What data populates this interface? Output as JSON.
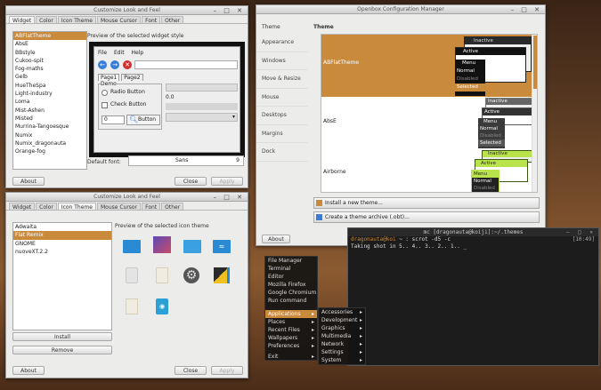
{
  "colors": {
    "accent": "#c98a3c",
    "terminal_bg": "#1c1c1c",
    "openbox_active": "#b9e34a"
  },
  "lxappearance_top": {
    "title": "Customize Look and Feel",
    "tabs": [
      "Widget",
      "Color",
      "Icon Theme",
      "Mouse Cursor",
      "Font",
      "Other"
    ],
    "themes": [
      "ABFlatTheme",
      "AbsE",
      "BBstyle",
      "Cukoo-spit",
      "Fog-maths",
      "Gelb",
      "HueTheSpa",
      "Light-industry",
      "Loma",
      "Mist-Ashen",
      "Misted",
      "Murrina-Tangoesque",
      "Numix",
      "Numix_dragonauta",
      "Orange-fog"
    ],
    "preview_label": "Preview of the selected widget style",
    "preview_menu": [
      "File",
      "Edit",
      "Help"
    ],
    "preview_tabs": [
      "Page1",
      "Page2"
    ],
    "preview_frame": "Demo",
    "radio_label": "Radio Button",
    "check_label": "Check Button",
    "spin_value": "0",
    "button_label": "Button",
    "scale_value": "0.0",
    "default_font_label": "Default font:",
    "default_font_value": "Sans",
    "font_size": "9",
    "about": "About",
    "close": "Close",
    "apply": "Apply"
  },
  "lxappearance_bottom": {
    "title": "Customize Look and Feel",
    "tabs": [
      "Widget",
      "Color",
      "Icon Theme",
      "Mouse Cursor",
      "Font",
      "Other"
    ],
    "icon_themes": [
      "Adwaita",
      "Flat Remix",
      "GNOME",
      "nuoveXT.2.2"
    ],
    "preview_label": "Preview of the selected icon theme",
    "install": "Install",
    "remove": "Remove",
    "about": "About",
    "close": "Close",
    "apply": "Apply"
  },
  "obconf": {
    "title": "Openbox Configuration Manager",
    "sidebar_header": "Theme",
    "sidebar": [
      "Appearance",
      "Windows",
      "Move & Resize",
      "Mouse",
      "Desktops",
      "Margins",
      "Dock"
    ],
    "main_header": "Theme",
    "themes": [
      "ABFlatTheme",
      "AbsE",
      "Airborne"
    ],
    "preview_inactive": "Inactive",
    "preview_active": "Active",
    "preview_menu": "Menu",
    "preview_normal": "Normal",
    "preview_disabled": "Disabled",
    "preview_selected": "Selected",
    "install_theme": "Install a new theme...",
    "create_archive": "Create a theme archive (.obt)...",
    "about": "About"
  },
  "terminal": {
    "title": "mc [dragonauta@koiji]:~/.themes",
    "prompt_user": "dragonauta@koi",
    "prompt_rest": " ~ : scrot -d5 -c",
    "time": "[10:49]",
    "line2": "Taking shot in 5.. 4.. 3.. 2.. 1.. _"
  },
  "root_menu": {
    "items": [
      "File Manager",
      "Terminal",
      "Editor",
      "Mozilla Firefox",
      "Google Chromium",
      "Run command",
      "Applications",
      "Places",
      "Recent Files",
      "Wallpapers",
      "Preferences",
      "Exit"
    ],
    "submenu": [
      "Accessories",
      "Development",
      "Graphics",
      "Multimedia",
      "Network",
      "Settings",
      "System"
    ]
  }
}
